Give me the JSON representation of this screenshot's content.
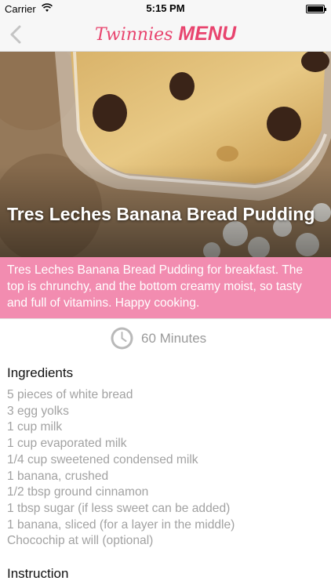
{
  "status_bar": {
    "carrier": "Carrier",
    "time": "5:15 PM"
  },
  "nav": {
    "title_part1": "Twinnies",
    "title_part2": "MENU"
  },
  "recipe": {
    "title": "Tres Leches Banana Bread Pudding",
    "description": "Tres Leches Banana Bread Pudding for breakfast. The top is chrunchy, and the bottom creamy moist, so tasty and full of vitamins. Happy cooking.",
    "time": "60 Minutes",
    "ingredients_heading": "Ingredients",
    "ingredients": [
      "5 pieces of white bread",
      "3 egg yolks",
      "1 cup milk",
      "1 cup evaporated milk",
      "1/4 cup sweetened condensed milk",
      "1 banana, crushed",
      "1/2 tbsp ground cinnamon",
      "1 tbsp sugar (if less sweet can be added)",
      "1 banana, sliced (for a layer in the middle)",
      "Chocochip at will (optional)"
    ],
    "instruction_heading": "Instruction"
  },
  "colors": {
    "accent": "#e8446e",
    "band": "#f28cb0",
    "muted_text": "#a2a2a2"
  }
}
